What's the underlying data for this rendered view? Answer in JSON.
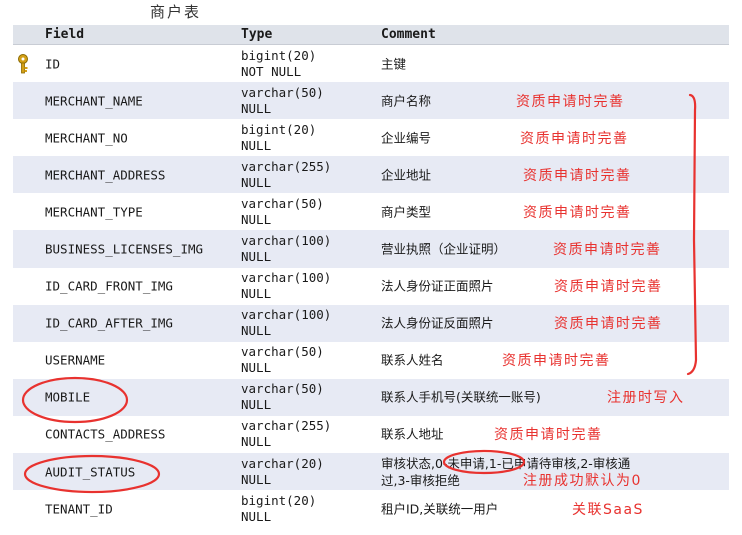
{
  "title": "商户表",
  "columns": {
    "field": "Field",
    "type": "Type",
    "comment": "Comment"
  },
  "rows": [
    {
      "field": "ID",
      "type1": "bigint(20)",
      "type2": "NOT NULL",
      "comment": "主键",
      "note": ""
    },
    {
      "field": "MERCHANT_NAME",
      "type1": "varchar(50)",
      "type2": "NULL",
      "comment": "商户名称",
      "note": "资质申请时完善"
    },
    {
      "field": "MERCHANT_NO",
      "type1": "bigint(20)",
      "type2": "NULL",
      "comment": "企业编号",
      "note": "资质申请时完善"
    },
    {
      "field": "MERCHANT_ADDRESS",
      "type1": "varchar(255)",
      "type2": "NULL",
      "comment": "企业地址",
      "note": "资质申请时完善"
    },
    {
      "field": "MERCHANT_TYPE",
      "type1": "varchar(50)",
      "type2": "NULL",
      "comment": "商户类型",
      "note": "资质申请时完善"
    },
    {
      "field": "BUSINESS_LICENSES_IMG",
      "type1": "varchar(100)",
      "type2": "NULL",
      "comment": "营业执照（企业证明）",
      "note": "资质申请时完善"
    },
    {
      "field": "ID_CARD_FRONT_IMG",
      "type1": "varchar(100)",
      "type2": "NULL",
      "comment": "法人身份证正面照片",
      "note": "资质申请时完善"
    },
    {
      "field": "ID_CARD_AFTER_IMG",
      "type1": "varchar(100)",
      "type2": "NULL",
      "comment": "法人身份证反面照片",
      "note": "资质申请时完善"
    },
    {
      "field": "USERNAME",
      "type1": "varchar(50)",
      "type2": "NULL",
      "comment": "联系人姓名",
      "note": "资质申请时完善"
    },
    {
      "field": "MOBILE",
      "type1": "varchar(50)",
      "type2": "NULL",
      "comment": "联系人手机号(关联统一账号)",
      "note": "注册时写入"
    },
    {
      "field": "CONTACTS_ADDRESS",
      "type1": "varchar(255)",
      "type2": "NULL",
      "comment": "联系人地址",
      "note": "资质申请时完善"
    },
    {
      "field": "AUDIT_STATUS",
      "type1": "varchar(20)",
      "type2": "NULL",
      "comment": "审核状态,0-未申请,1-已申请待审核,2-审核通",
      "comment2": "过,3-审核拒绝",
      "note": "注册成功默认为0"
    },
    {
      "field": "TENANT_ID",
      "type1": "bigint(20)",
      "type2": "NULL",
      "comment": "租户ID,关联统一用户",
      "note": "关联SaaS"
    }
  ],
  "colors": {
    "annotation": "#e8322f",
    "header_bg": "#dfe3ea",
    "row_shade": "#e7eaf4",
    "key": "#d4a017"
  },
  "icons": {
    "primary_key": "key-icon"
  }
}
